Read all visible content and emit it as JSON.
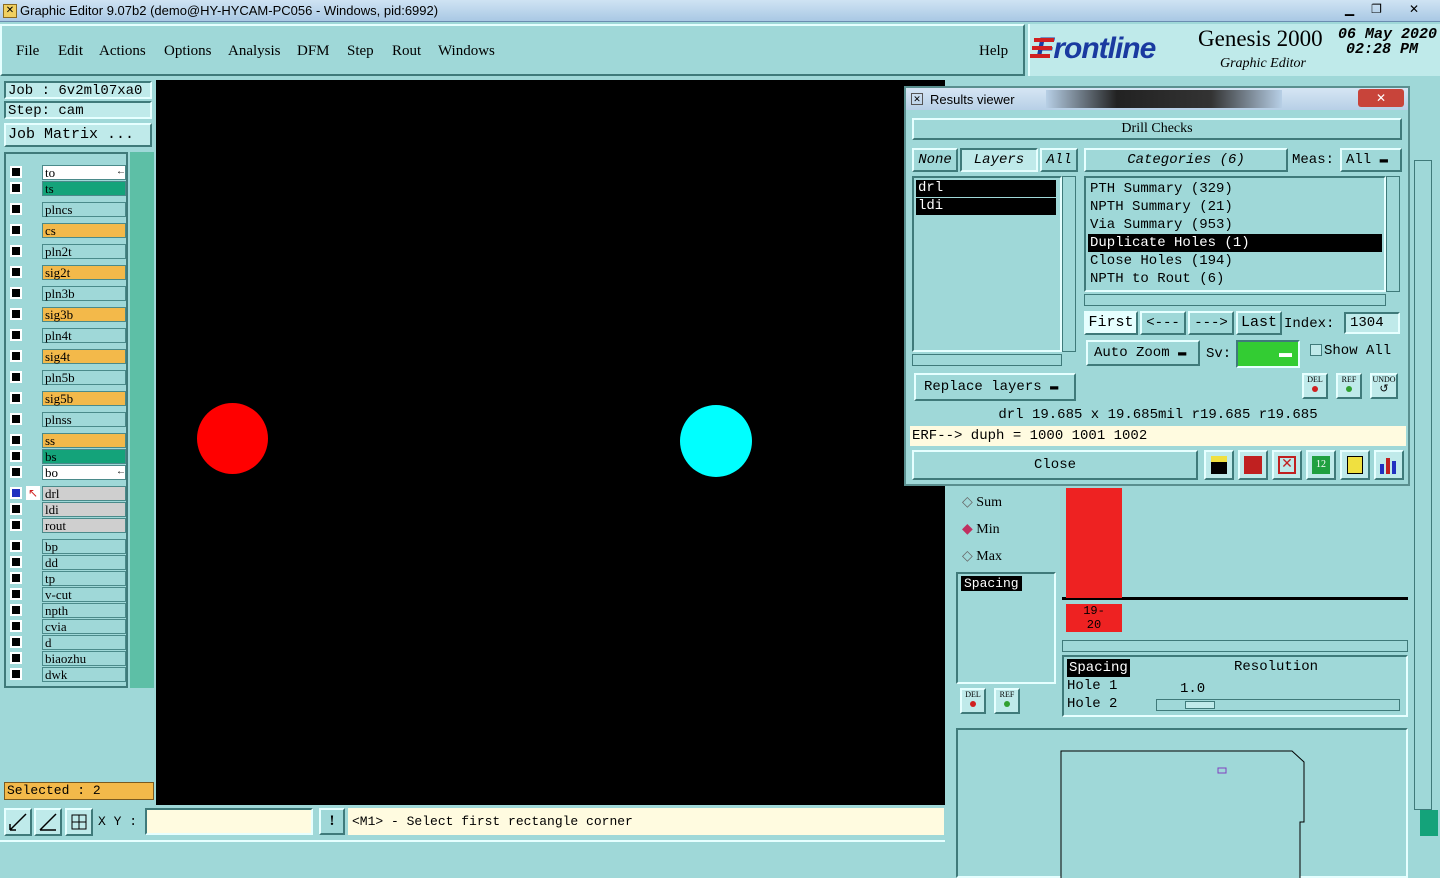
{
  "window": {
    "title": "Graphic Editor 9.07b2 (demo@HY-HYCAM-PC056 - Windows, pid:6992)"
  },
  "menu": {
    "file": "File",
    "edit": "Edit",
    "actions": "Actions",
    "options": "Options",
    "analysis": "Analysis",
    "dfm": "DFM",
    "step": "Step",
    "rout": "Rout",
    "windows": "Windows",
    "help": "Help"
  },
  "brand": {
    "logo": "Frontline",
    "product": "Genesis 2000",
    "subtitle": "Graphic Editor",
    "date": "06 May 2020",
    "time": "02:28 PM"
  },
  "job": {
    "job": "Job : 6v2ml07xa0",
    "step": "Step: cam",
    "matrix": "Job Matrix ..."
  },
  "layers": [
    {
      "name": "to",
      "color": "#ffffff",
      "marker": "←"
    },
    {
      "name": "ts",
      "color": "#14a37a"
    },
    {
      "name": "plncs",
      "color": "#9fd8d8"
    },
    {
      "name": "cs",
      "color": "#f3b94a"
    },
    {
      "name": "pln2t",
      "color": "#9fd8d8"
    },
    {
      "name": "sig2t",
      "color": "#f3b94a"
    },
    {
      "name": "pln3b",
      "color": "#9fd8d8"
    },
    {
      "name": "sig3b",
      "color": "#f3b94a"
    },
    {
      "name": "pln4t",
      "color": "#9fd8d8"
    },
    {
      "name": "sig4t",
      "color": "#f3b94a"
    },
    {
      "name": "pln5b",
      "color": "#9fd8d8"
    },
    {
      "name": "sig5b",
      "color": "#f3b94a"
    },
    {
      "name": "plnss",
      "color": "#9fd8d8"
    },
    {
      "name": "ss",
      "color": "#f3b94a"
    },
    {
      "name": "bs",
      "color": "#14a37a"
    },
    {
      "name": "bo",
      "color": "#ffffff",
      "marker": "←"
    },
    {
      "name": "drl",
      "color": "#cfcfcf"
    },
    {
      "name": "ldi",
      "color": "#cfcfcf"
    },
    {
      "name": "rout",
      "color": "#cfcfcf"
    },
    {
      "name": "bp",
      "color": "#9fd8d8"
    },
    {
      "name": "dd",
      "color": "#9fd8d8"
    },
    {
      "name": "tp",
      "color": "#9fd8d8"
    },
    {
      "name": "v-cut",
      "color": "#9fd8d8"
    },
    {
      "name": "npth",
      "color": "#9fd8d8"
    },
    {
      "name": "cvia",
      "color": "#9fd8d8"
    },
    {
      "name": "d",
      "color": "#9fd8d8"
    },
    {
      "name": "biaozhu",
      "color": "#9fd8d8"
    },
    {
      "name": "dwk",
      "color": "#9fd8d8"
    }
  ],
  "selected": "Selected : 2",
  "status": {
    "xy_label": "X Y :",
    "xy_value": "",
    "alert": "!",
    "prompt": "<M1> - Select first rectangle corner"
  },
  "results": {
    "title": "Results viewer",
    "header": "Drill Checks",
    "none": "None",
    "layers_tab": "Layers",
    "all": "All",
    "categories": "Categories (6)",
    "meas_label": "Meas:",
    "meas_value": "All",
    "layer_items": [
      "drl",
      "ldi"
    ],
    "category_items": [
      "PTH Summary (329)",
      "NPTH Summary (21)",
      "Via Summary (953)",
      "Duplicate Holes (1)",
      "Close Holes (194)",
      "NPTH to Rout (6)"
    ],
    "selected_category": "Duplicate Holes (1)",
    "first": "First",
    "prev": "<---",
    "next": "--->",
    "last": "Last",
    "index_label": "Index:",
    "index_value": "1304",
    "auto_zoom": "Auto Zoom",
    "sv_label": "Sv:",
    "sv_color": "#33cc33",
    "show_all": "Show All",
    "replace_layers": "Replace layers",
    "del": "DEL",
    "ref": "REF",
    "undo": "UNDO",
    "info": "drl  19.685 x 19.685mil   r19.685   r19.685",
    "erf": "ERF--> duph = 1000 1001 1002",
    "close": "Close"
  },
  "histogram": {
    "sum": "Sum",
    "min": "Min",
    "max": "Max",
    "list_item": "Spacing",
    "bar_label": "19-\n20",
    "bar_color": "#ee2222",
    "sub_list": [
      "Spacing",
      "Hole 1",
      "Hole 2"
    ],
    "resolution_label": "Resolution",
    "resolution_value": "1.0",
    "del": "DEL",
    "ref": "REF"
  },
  "canvas": {
    "circle_left_color": "#ff0000",
    "circle_right_color": "#00ffff"
  }
}
